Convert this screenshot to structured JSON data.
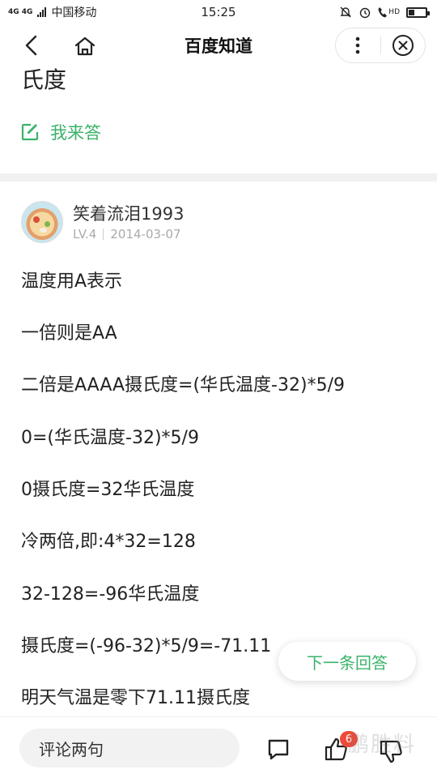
{
  "status_bar": {
    "network": "4G 4G",
    "carrier": "中国移动",
    "time": "15:25",
    "hd": "HD"
  },
  "nav": {
    "title": "百度知道"
  },
  "question_tail": "氏度",
  "answer_action": "我来答",
  "answer": {
    "user_name": "笑着流泪1993",
    "level": "LV.4",
    "date": "2014-03-07",
    "lines": [
      "温度用A表示",
      "一倍则是AA",
      "二倍是AAAA摄氏度=(华氏温度-32)*5/9",
      "0=(华氏温度-32)*5/9",
      "0摄氏度=32华氏温度",
      "冷两倍,即:4*32=128",
      "32-128=-96华氏温度",
      "摄氏度=(-96-32)*5/9=-71.11",
      "明天气温是零下71.11摄氏度"
    ]
  },
  "next_answer_label": "下一条回答",
  "bottom": {
    "comment_placeholder": "评论两句",
    "like_count": "6",
    "watermark": "鹏胜料"
  },
  "colors": {
    "accent_green": "#3bb36a",
    "badge_red": "#ee4a3a"
  }
}
